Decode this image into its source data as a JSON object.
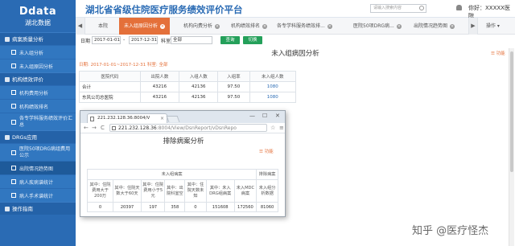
{
  "brand": {
    "title": "Ddata",
    "subtitle": "湖北数据"
  },
  "sidebar": {
    "sections": [
      {
        "label": "病案质量分析",
        "items": [
          "未入组分析",
          "未入组原因分析"
        ]
      },
      {
        "label": "机构绩效评价",
        "items": [
          "机构费用分析",
          "机构绩效排名",
          "各专学科服务绩效评价汇总"
        ]
      },
      {
        "label": "DRGs应用",
        "items": [
          "医院50项DRG病组费用公示",
          "出院情况趋势图",
          "病人疾病谱统计",
          "病人手术谱统计"
        ]
      },
      {
        "label": "操作指南",
        "items": []
      }
    ]
  },
  "header": {
    "title": "湖北省省级住院医疗服务绩效评价平台",
    "search_placeholder": "请输入搜索内容",
    "user": "你好：XXXXX医院"
  },
  "tabs": {
    "prev": "◀",
    "items": [
      {
        "label": "本院"
      },
      {
        "label": "未入组原因分析"
      },
      {
        "label": "机构向费分析"
      },
      {
        "label": "机构绩效排名"
      },
      {
        "label": "各专学科服务绩效排..."
      },
      {
        "label": "医院50项DRG病..."
      },
      {
        "label": "出院情况趋势图"
      }
    ],
    "next": "▶",
    "ops": "操作"
  },
  "filter": {
    "date_label": "日期",
    "date_from": "2017-01-01",
    "sep": "-",
    "date_to": "2017-12-31",
    "dept_label": "科室",
    "dept_value": "全部",
    "query_btn": "查询",
    "export_btn": "切换"
  },
  "panel": {
    "title": "未入组病因分析",
    "feature_link": "☰ 功能",
    "date_info": "日期: 2017-01-01~2017-12-31 科室: 全部"
  },
  "main_table": {
    "headers": [
      "医院代码",
      "出院人数",
      "入组人数",
      "入组率",
      "未入组人数"
    ],
    "rows": [
      [
        "合计",
        "43216",
        "42136",
        "97.50",
        "1080"
      ],
      [
        "东风公司总医院",
        "43216",
        "42136",
        "97.50",
        "1080"
      ]
    ]
  },
  "popup": {
    "tab_title": "221.232.128.36:8004/V",
    "tab_close": "×",
    "win_min": "—",
    "win_max": "☐",
    "win_close": "✕",
    "back": "←",
    "forward": "→",
    "reload": "C",
    "url_host": "221.232.128.36",
    "url_path": ":8004/View/DsnReport/vDsnRepo",
    "star": "☆",
    "menu": "≡",
    "title": "排除病案分析",
    "feature_link": "☰ 功能",
    "group_header_1": "未入组病案",
    "group_header_2": "排除病案",
    "headers": [
      "其中：住院费用大于200万",
      "其中：住院天数大于60天",
      "其中：住院费用小于5元",
      "其中：出院科室空",
      "其中：住院天数未知",
      "其中：未入DRG组病案",
      "未入MDC病案",
      "未入组分析数据"
    ],
    "row": [
      "0",
      "20397",
      "197",
      "358",
      "0",
      "151608",
      "172560",
      "81060"
    ]
  },
  "watermark": "知乎 @医疗怪杰"
}
